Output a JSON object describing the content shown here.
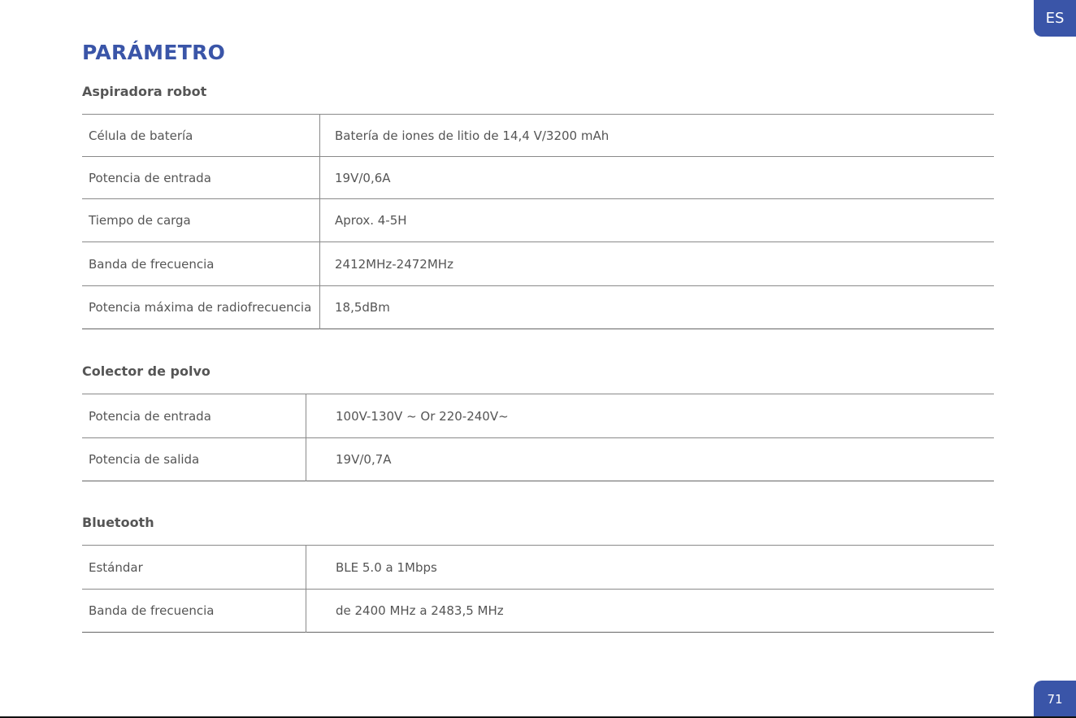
{
  "language_tab": "ES",
  "page_number": "71",
  "title": "PARÁMETRO",
  "sections": [
    {
      "heading": "Aspiradora robot",
      "rows": [
        {
          "label": "Célula de batería",
          "value": "Batería de iones de litio de 14,4 V/3200 mAh"
        },
        {
          "label": "Potencia de entrada",
          "value": "19V/0,6A"
        },
        {
          "label": "Tiempo de carga",
          "value": "Aprox. 4-5H"
        },
        {
          "label": "Banda de frecuencia",
          "value": "2412MHz-2472MHz"
        },
        {
          "label": "Potencia máxima de radiofrecuencia",
          "value": "18,5dBm"
        }
      ]
    },
    {
      "heading": "Colector de polvo",
      "rows": [
        {
          "label": "Potencia de entrada",
          "value": "100V-130V ~ Or 220-240V~"
        },
        {
          "label": "Potencia de salida",
          "value": "19V/0,7A"
        }
      ]
    },
    {
      "heading": "Bluetooth",
      "rows": [
        {
          "label": "Estándar",
          "value": "BLE 5.0 a 1Mbps"
        },
        {
          "label": "Banda de frecuencia",
          "value": "de 2400 MHz a 2483,5 MHz"
        }
      ]
    }
  ]
}
